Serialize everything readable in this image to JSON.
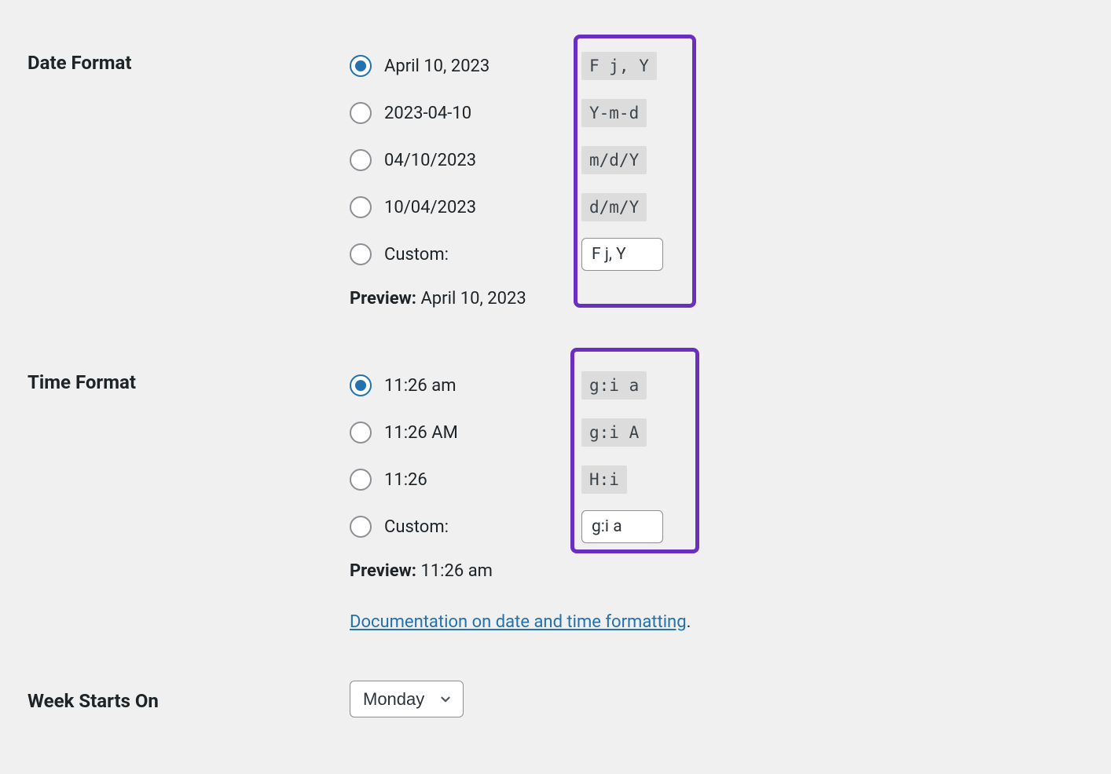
{
  "date_format": {
    "label": "Date Format",
    "options": [
      {
        "display": "April 10, 2023",
        "code": "F j, Y",
        "checked": true
      },
      {
        "display": "2023-04-10",
        "code": "Y-m-d",
        "checked": false
      },
      {
        "display": "04/10/2023",
        "code": "m/d/Y",
        "checked": false
      },
      {
        "display": "10/04/2023",
        "code": "d/m/Y",
        "checked": false
      }
    ],
    "custom_label": "Custom:",
    "custom_value": "F j, Y",
    "preview_label": "Preview:",
    "preview_value": "April 10, 2023"
  },
  "time_format": {
    "label": "Time Format",
    "options": [
      {
        "display": "11:26 am",
        "code": "g:i a",
        "checked": true
      },
      {
        "display": "11:26 AM",
        "code": "g:i A",
        "checked": false
      },
      {
        "display": "11:26",
        "code": "H:i",
        "checked": false
      }
    ],
    "custom_label": "Custom:",
    "custom_value": "g:i a",
    "preview_label": "Preview:",
    "preview_value": "11:26 am"
  },
  "doc_link": {
    "text": "Documentation on date and time formatting",
    "trailing": "."
  },
  "week_starts": {
    "label": "Week Starts On",
    "value": "Monday"
  }
}
